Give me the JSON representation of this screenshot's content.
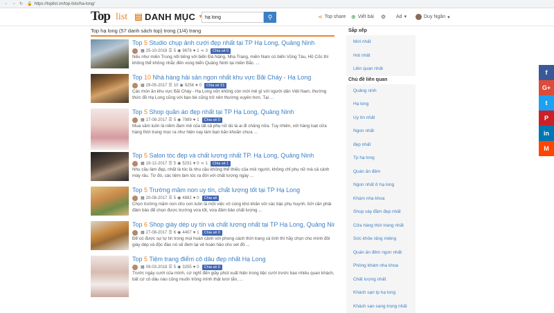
{
  "browser": {
    "url": "https://toplist.vn/top-lists/ha-long/"
  },
  "header": {
    "logo_top": "Top",
    "logo_list": "list",
    "menu_title": "DANH MỤC",
    "search_value": "hạ long",
    "top_share": "Top share",
    "viet_bai": "Viết bài",
    "admin": "Ad",
    "user": "Duy Ngân"
  },
  "results_title": "Top hạ long (57 danh sách top) trong (1/4) trang",
  "items": [
    {
      "num": "5",
      "title": "Studio chụp ảnh cưới đẹp nhất tại TP Hạ Long, Quảng Ninh",
      "date": "25-10-2018",
      "count": "5",
      "views": "9678",
      "likes": "1",
      "shares": "3",
      "fb": "Chia sẻ 0",
      "desc": "Nếu như miền Trung nổi tiếng với biển Đà Nẵng, Nha Trang, miền Nam có biển Vũng Tàu, Hồ Cốc thì không thể không nhắc đến vùng biển Quảng Ninh tại miền Bắc. ..."
    },
    {
      "num": "10",
      "title": "Nhà hàng hải sản ngon nhất khu vực Bãi Cháy - Hạ Long",
      "date": "29-05-2017",
      "count": "10",
      "views": "9256",
      "likes": "0",
      "shares": "",
      "fb": "Chia sẻ 21",
      "desc": "Các món ăn khu vực Bãi Cháy - Hạ Long vốn không còn mới mẻ gì với người dân Việt Nam, thường thức đồ Hạ Long cũng với bạn bè cũng trở nên thường xuyên hơn. Tại ..."
    },
    {
      "num": "5",
      "title": "Shop quần áo đẹp nhất tại TP Hạ Long, Quảng Ninh",
      "date": "17-08-2017",
      "count": "5",
      "views": "7989",
      "likes": "1",
      "shares": "",
      "fb": "Chia sẻ 0",
      "desc": "Mua sắm luôn là niềm đam mê của tất cả phụ nữ dù là ai đi chăng nữa. Tuy nhiên, với hàng loạt cửa hàng thời trang mọc ra như hiện nay làm bạn băn khoăn chưa ..."
    },
    {
      "num": "5",
      "title": "Salon tóc đẹp và chất lượng nhất TP. Hạ Long, Quảng Ninh",
      "date": "19-12-2017",
      "count": "5",
      "views": "5231",
      "likes": "0",
      "shares": "1",
      "fb": "Chia sẻ 1",
      "desc": "Nhu cầu làm đẹp, nhất là tóc là nhu cầu không thể thiếu của mỗi người, không chỉ phụ nữ mà cả cánh mày râu. Từ đó, các tiệm làm tóc ra đời với chất lượng ngày ..."
    },
    {
      "num": "5",
      "title": "Trường mầm non uy tín, chất lượng tốt tại TP Hạ Long",
      "date": "20-08-2017",
      "count": "5",
      "views": "4882",
      "likes": "0",
      "shares": "",
      "fb": "Chia sẻ",
      "desc": "Chọn trường mầm non cho con luôn là một việc vô cùng khó khăn với các bậc phụ huynh, bởi cần phải đảm bảo để chọn được trường vừa tốt, vừa đảm bảo chất lượng ..."
    },
    {
      "num": "6",
      "title": "Shop giày dép uy tín và chất lượng nhất tại TP Hạ Long, Quảng Ninh",
      "date": "27-08-2017",
      "count": "6",
      "views": "4407",
      "likes": "1",
      "shares": "",
      "fb": "Chia sẻ 0",
      "desc": "Để có được sự tự tin trong mọi hoàn cảnh với phong cách thời trang cá tính thì hãy chọn cho mình đôi giày dép và độc đáo nó sẽ đem lại vẻ hoàn hảo cho set đồ ..."
    },
    {
      "num": "5",
      "title": "Tiệm trang điểm cô dâu đẹp nhất Hạ Long",
      "date": "09-03-2018",
      "count": "5",
      "views": "3255",
      "likes": "0",
      "shares": "",
      "fb": "Chia sẻ 0",
      "desc": "Trước ngày cưới của mình, cứ nghĩ đến giây phút xuất hiện trong tiệc cưới trước bao nhiêu quan khách, bất cứ cô dâu nào cũng muốn trông mình thật lươi tắn, ..."
    }
  ],
  "sidebar": {
    "sort_head": "Sắp xếp",
    "sort": [
      "Mới nhất",
      "Hot nhất",
      "Liên quan nhất"
    ],
    "topic_head": "Chủ đề liên quan",
    "topics": [
      "Quảng ninh",
      "Hạ long",
      "Uy tín nhất",
      "Ngon nhất",
      "đẹp nhất",
      "Tp hạ long",
      "Quán ăn đêm",
      "Ngon nhất ở hạ long",
      "Khám nha khoa",
      "Shop váy đầm đẹp nhất",
      "Cửa hàng thời trang nhất",
      "Sức khỏe răng miệng",
      "Quán ăn đêm ngon nhất",
      "Phòng khám nha khoa",
      "Chất lượng nhất",
      "Khách sạn tp hạ long",
      "Khách sạn sang trọng nhất"
    ]
  },
  "social": [
    "f",
    "G+",
    "t",
    "P",
    "in",
    "M"
  ]
}
